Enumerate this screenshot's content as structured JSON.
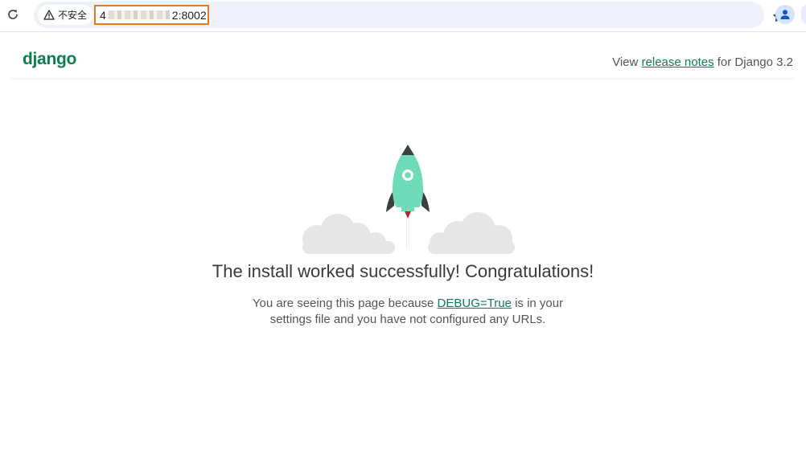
{
  "browser": {
    "security_label": "不安全",
    "url_prefix": "4",
    "url_suffix": "2:8002"
  },
  "header": {
    "logo_text": "django",
    "release_prefix": "View ",
    "release_link": "release notes",
    "release_suffix": " for Django 3.2"
  },
  "main": {
    "headline": "The install worked successfully! Congratulations!",
    "desc_prefix": "You are seeing this page because ",
    "desc_link": "DEBUG=True",
    "desc_suffix": " is in your settings file and you have not configured any URLs."
  },
  "colors": {
    "accent": "#107b54",
    "rocket_body": "#6fdbb8",
    "rocket_fin": "#3b3f3f",
    "flame": "#b5253a",
    "cloud": "#e6e6e6",
    "url_highlight": "#e07a1f"
  },
  "icons": {
    "reload": "reload-icon",
    "warning": "warning-icon",
    "star": "star-icon",
    "profile": "profile-icon",
    "rocket": "rocket-icon"
  }
}
